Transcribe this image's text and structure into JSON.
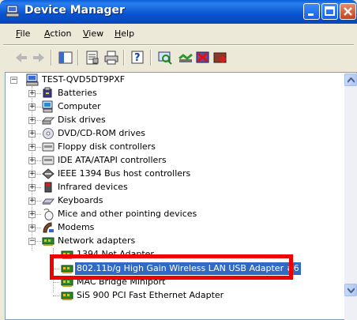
{
  "window": {
    "title": "Device Manager"
  },
  "menu": {
    "items": [
      {
        "label": "File",
        "key": "F"
      },
      {
        "label": "Action",
        "key": "A"
      },
      {
        "label": "View",
        "key": "V"
      },
      {
        "label": "Help",
        "key": "H"
      }
    ]
  },
  "toolbar": {
    "buttons": [
      "back-icon",
      "forward-icon",
      "show-hide-console-tree-icon",
      "properties-icon",
      "print-icon",
      "help-icon",
      "scan-hardware-icon",
      "update-driver-icon",
      "uninstall-icon",
      "disable-icon"
    ]
  },
  "tree": {
    "root": "TEST-QVD5DT9PXF",
    "categories": [
      {
        "label": "Batteries",
        "expanded": false
      },
      {
        "label": "Computer",
        "expanded": false
      },
      {
        "label": "Disk drives",
        "expanded": false
      },
      {
        "label": "DVD/CD-ROM drives",
        "expanded": false
      },
      {
        "label": "Floppy disk controllers",
        "expanded": false
      },
      {
        "label": "IDE ATA/ATAPI controllers",
        "expanded": false
      },
      {
        "label": "IEEE 1394 Bus host controllers",
        "expanded": false
      },
      {
        "label": "Infrared devices",
        "expanded": false
      },
      {
        "label": "Keyboards",
        "expanded": false
      },
      {
        "label": "Mice and other pointing devices",
        "expanded": false
      },
      {
        "label": "Modems",
        "expanded": false
      },
      {
        "label": "Network adapters",
        "expanded": true
      }
    ],
    "network_children": [
      {
        "label": "1394 Net Adapter",
        "selected": false
      },
      {
        "label": "802.11b/g High Gain Wireless LAN USB Adapter #6",
        "selected": true
      },
      {
        "label": "MAC Bridge Miniport",
        "selected": false
      },
      {
        "label": "SiS 900 PCI Fast Ethernet Adapter",
        "selected": false
      }
    ]
  },
  "colors": {
    "titlebar": "#0a5fd8",
    "selection": "#316ac5",
    "highlight_box": "#ee0000"
  }
}
